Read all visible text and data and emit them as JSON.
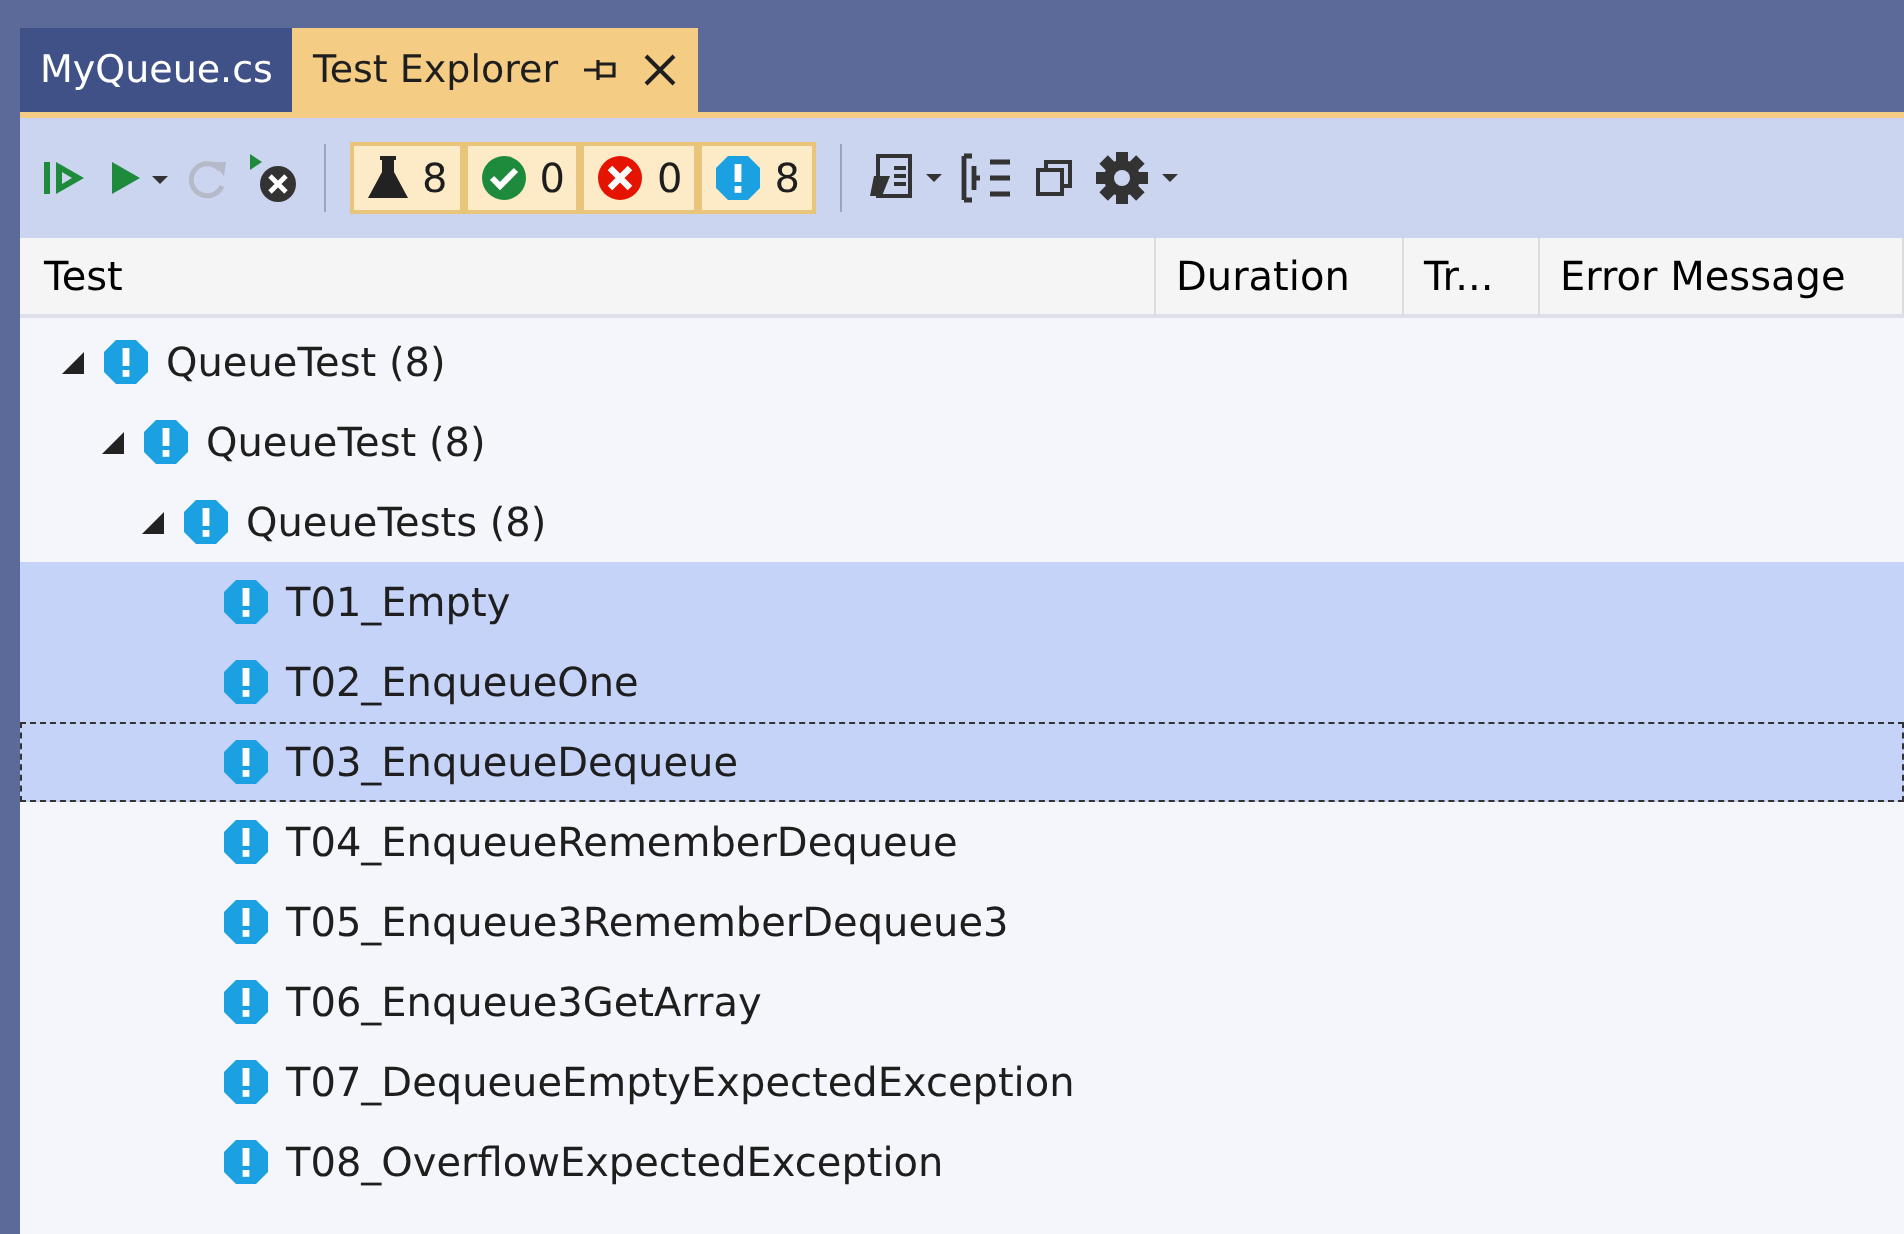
{
  "tabs": [
    {
      "label": "MyQueue.cs",
      "selected": false,
      "pinnable": false
    },
    {
      "label": "Test Explorer",
      "selected": true,
      "pinnable": true
    }
  ],
  "counters": [
    {
      "kind": "total",
      "count": "8"
    },
    {
      "kind": "passed",
      "count": "0"
    },
    {
      "kind": "failed",
      "count": "0"
    },
    {
      "kind": "notrun",
      "count": "8"
    }
  ],
  "columns": [
    "Test",
    "Duration",
    "Tr...",
    "Error Message"
  ],
  "tree": [
    {
      "label": "QueueTest (8)",
      "expanded": true,
      "selected": false,
      "focused": false,
      "children": [
        {
          "label": "QueueTest (8)",
          "expanded": true,
          "selected": false,
          "focused": false,
          "children": [
            {
              "label": "QueueTests (8)",
              "expanded": true,
              "selected": false,
              "focused": false,
              "children": [
                {
                  "label": "T01_Empty",
                  "selected": true,
                  "focused": false
                },
                {
                  "label": "T02_EnqueueOne",
                  "selected": true,
                  "focused": false
                },
                {
                  "label": "T03_EnqueueDequeue",
                  "selected": true,
                  "focused": true
                },
                {
                  "label": "T04_EnqueueRememberDequeue",
                  "selected": false,
                  "focused": false
                },
                {
                  "label": "T05_Enqueue3RememberDequeue3",
                  "selected": false,
                  "focused": false
                },
                {
                  "label": "T06_Enqueue3GetArray",
                  "selected": false,
                  "focused": false
                },
                {
                  "label": "T07_DequeueEmptyExpectedException",
                  "selected": false,
                  "focused": false
                },
                {
                  "label": "T08_OverflowExpectedException",
                  "selected": false,
                  "focused": false
                }
              ]
            }
          ]
        }
      ]
    }
  ]
}
